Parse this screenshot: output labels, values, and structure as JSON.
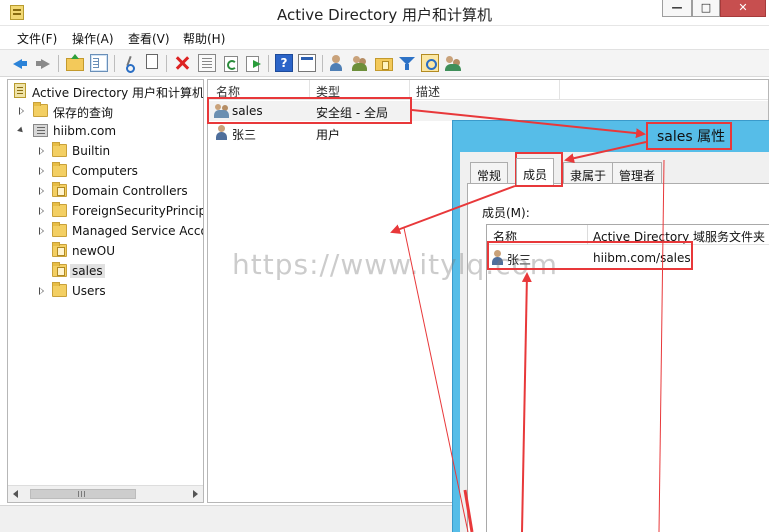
{
  "window": {
    "title": "Active Directory 用户和计算机",
    "controls": {
      "minimize": "—",
      "maximize": "□",
      "close": "✕"
    }
  },
  "menu": {
    "items": [
      {
        "label": "文件(F)"
      },
      {
        "label": "操作(A)"
      },
      {
        "label": "查看(V)"
      },
      {
        "label": "帮助(H)"
      }
    ]
  },
  "toolbar": {
    "icons": [
      "back-arrow-icon",
      "forward-arrow-icon",
      "folder-up-icon",
      "show-tree-icon",
      "cut-icon",
      "copy-icon",
      "delete-icon",
      "properties-icon",
      "refresh-icon",
      "export-list-icon",
      "help-icon",
      "console-icon",
      "new-user-icon",
      "new-group-icon",
      "new-ou-icon",
      "filter-icon",
      "find-icon",
      "add-to-group-icon"
    ]
  },
  "tree": {
    "root": "Active Directory 用户和计算机",
    "items": [
      {
        "label": "保存的查询"
      },
      {
        "label": "hiibm.com"
      },
      {
        "label": "Builtin"
      },
      {
        "label": "Computers"
      },
      {
        "label": "Domain Controllers"
      },
      {
        "label": "ForeignSecurityPrincipals"
      },
      {
        "label": "Managed Service Accounts"
      },
      {
        "label": "newOU"
      },
      {
        "label": "sales"
      },
      {
        "label": "Users"
      }
    ]
  },
  "list": {
    "columns": {
      "name": "名称",
      "type": "类型",
      "desc": "描述"
    },
    "rows": [
      {
        "name": "sales",
        "type": "安全组 - 全局",
        "desc": ""
      },
      {
        "name": "张三",
        "type": "用户",
        "desc": ""
      }
    ]
  },
  "dialog": {
    "title": "sales 属性",
    "tabs": [
      {
        "label": "常规"
      },
      {
        "label": "成员"
      },
      {
        "label": "隶属于"
      },
      {
        "label": "管理者"
      }
    ],
    "members_label": "成员(M):",
    "members_columns": {
      "name": "名称",
      "folder": "Active Directory 域服务文件夹"
    },
    "members": [
      {
        "name": "张三",
        "folder": "hiibm.com/sales"
      }
    ]
  },
  "watermark": "https://www.itylq.com",
  "colors": {
    "annotation_red": "#e8383a",
    "dialog_frame": "#56bde8"
  }
}
